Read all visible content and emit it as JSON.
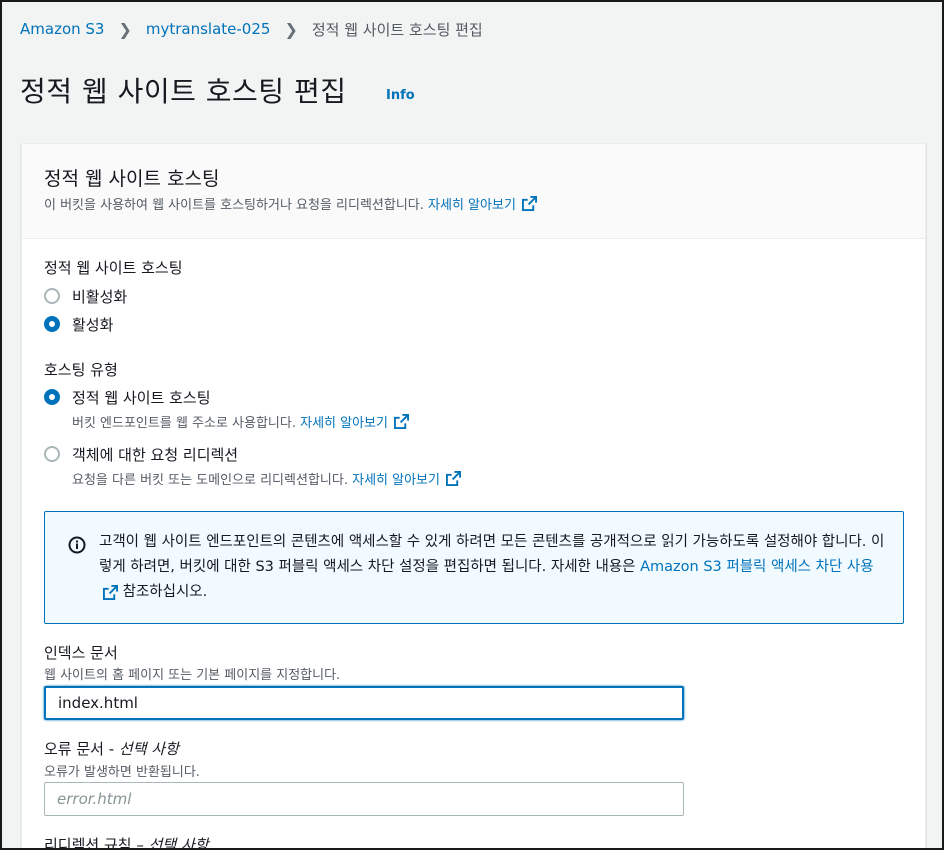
{
  "breadcrumb": {
    "items": [
      "Amazon S3",
      "mytranslate-025"
    ],
    "current": "정적 웹 사이트 호스팅 편집"
  },
  "page": {
    "title": "정적 웹 사이트 호스팅 편집",
    "info_label": "Info"
  },
  "panel": {
    "title": "정적 웹 사이트 호스팅",
    "description": "이 버킷을 사용하여 웹 사이트를 호스팅하거나 요청을 리디렉션합니다.",
    "learn_more": "자세히 알아보기"
  },
  "hosting": {
    "label": "정적 웹 사이트 호스팅",
    "options": [
      {
        "label": "비활성화",
        "checked": false
      },
      {
        "label": "활성화",
        "checked": true
      }
    ]
  },
  "hosting_type": {
    "label": "호스팅 유형",
    "options": [
      {
        "label": "정적 웹 사이트 호스팅",
        "desc": "버킷 엔드포인트를 웹 주소로 사용합니다.",
        "link": "자세히 알아보기",
        "checked": true
      },
      {
        "label": "객체에 대한 요청 리디렉션",
        "desc": "요청을 다른 버킷 또는 도메인으로 리디렉션합니다.",
        "link": "자세히 알아보기",
        "checked": false
      }
    ]
  },
  "alert": {
    "text_before": "고객이 웹 사이트 엔드포인트의 콘텐츠에 액세스할 수 있게 하려면 모든 콘텐츠를 공개적으로 읽기 가능하도록 설정해야 합니다. 이렇게 하려면, 버킷에 대한 S3 퍼블릭 액세스 차단 설정을 편집하면 됩니다. 자세한 내용은 ",
    "link": "Amazon S3 퍼블릭 액세스 차단 사용",
    "text_after": " 참조하십시오."
  },
  "index_document": {
    "label": "인덱스 문서",
    "hint": "웹 사이트의 홈 페이지 또는 기본 페이지를 지정합니다.",
    "value": "index.html"
  },
  "error_document": {
    "label": "오류 문서 - ",
    "optional": "선택 사항",
    "hint": "오류가 발생하면 반환됩니다.",
    "placeholder": "error.html"
  },
  "redirect_rules": {
    "label": "리디렉션 규칙 – ",
    "optional": "선택 사항"
  },
  "colors": {
    "link": "#0073bb",
    "background": "#f2f3f3",
    "panel": "#ffffff",
    "alert_bg": "#f1faff"
  }
}
